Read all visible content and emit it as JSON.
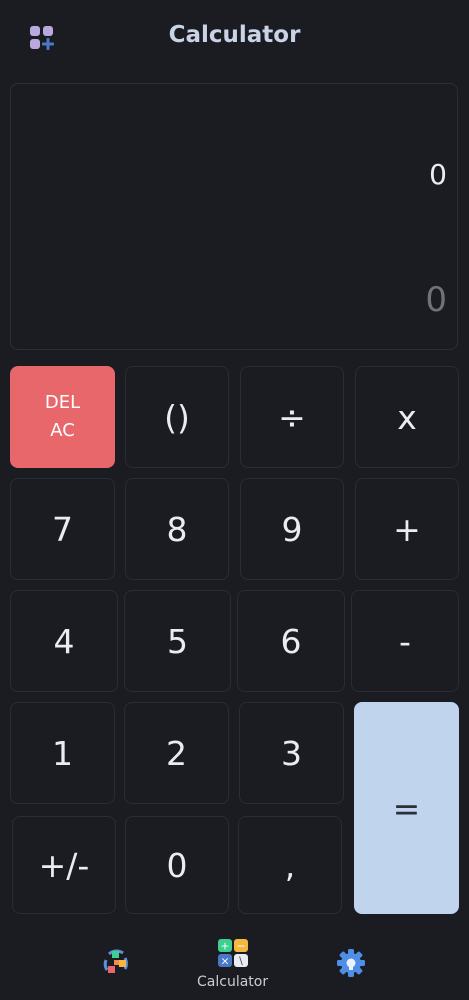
{
  "header": {
    "title": "Calculator",
    "apps_icon": "apps-add-icon"
  },
  "display": {
    "expression": "0",
    "result": "0"
  },
  "keys": {
    "del_label": "DEL",
    "ac_label": "AC",
    "parens": "()",
    "divide": "÷",
    "multiply": "x",
    "seven": "7",
    "eight": "8",
    "nine": "9",
    "plus": "+",
    "four": "4",
    "five": "5",
    "six": "6",
    "minus": "-",
    "one": "1",
    "two": "2",
    "three": "3",
    "equals": "=",
    "sign": "+/-",
    "zero": "0",
    "decimal": ","
  },
  "nav": {
    "items": [
      {
        "icon": "unit-converter-icon",
        "label": ""
      },
      {
        "icon": "calculator-icon",
        "label": "Calculator"
      },
      {
        "icon": "settings-gear-icon",
        "label": ""
      }
    ]
  },
  "colors": {
    "background": "#1b1c22",
    "del_key": "#e8676b",
    "equals_key": "#c0d4ee",
    "title": "#c9d3e6"
  }
}
